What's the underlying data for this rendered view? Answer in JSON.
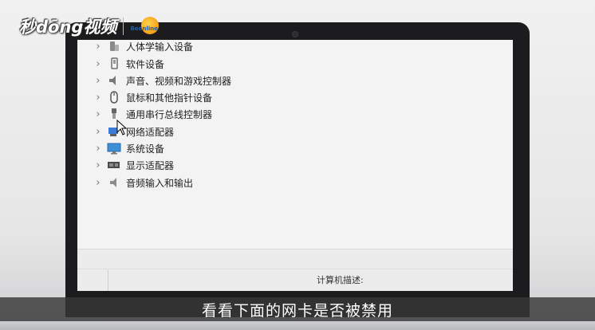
{
  "watermark": {
    "text": "秒dōng视频",
    "logo_text": "Beonline"
  },
  "device_manager": {
    "items": [
      {
        "label": "人体学输入设备",
        "icon": "hid-icon"
      },
      {
        "label": "软件设备",
        "icon": "software-device-icon"
      },
      {
        "label": "声音、视频和游戏控制器",
        "icon": "speaker-icon"
      },
      {
        "label": "鼠标和其他指针设备",
        "icon": "mouse-icon"
      },
      {
        "label": "通用串行总线控制器",
        "icon": "usb-icon"
      },
      {
        "label": "网络适配器",
        "icon": "network-adapter-icon"
      },
      {
        "label": "系统设备",
        "icon": "monitor-icon"
      },
      {
        "label": "显示适配器",
        "icon": "display-adapter-icon"
      },
      {
        "label": "音频输入和输出",
        "icon": "audio-io-icon"
      }
    ],
    "expand_glyph": "›"
  },
  "computer_description_label": "计算机描述:",
  "subtitle": "看看下面的网卡是否被禁用",
  "colors": {
    "laptop_bezel": "#1c1c1e",
    "screen_bg": "#f3f3f3",
    "subtitle_band": "#373737"
  }
}
